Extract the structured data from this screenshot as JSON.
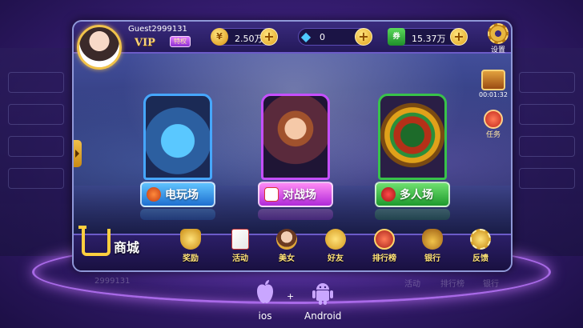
{
  "header": {
    "guest_name": "Guest2999131",
    "vip_label": "VIP",
    "vip_badge": "特权"
  },
  "resources": [
    {
      "name": "gold",
      "value": "2.50万",
      "icon": "coin-icon"
    },
    {
      "name": "diamond",
      "value": "0",
      "icon": "diamond-icon"
    },
    {
      "name": "ticket",
      "value": "15.37万",
      "icon": "ticket-icon",
      "icon_text": "券"
    }
  ],
  "settings_label": "设置",
  "chest_timer": "00:01:32",
  "task_label": "任务",
  "games": [
    {
      "label": "电玩场",
      "color": "#2f86e0"
    },
    {
      "label": "对战场",
      "color": "#c23ae0"
    },
    {
      "label": "多人场",
      "color": "#2aa83a"
    }
  ],
  "shop_label": "商城",
  "nav": [
    {
      "label": "奖励",
      "icon": "trophy-icon"
    },
    {
      "label": "活动",
      "icon": "cards-icon"
    },
    {
      "label": "美女",
      "icon": "girl-icon"
    },
    {
      "label": "好友",
      "icon": "friends-icon"
    },
    {
      "label": "排行榜",
      "icon": "ranking-icon"
    },
    {
      "label": "银行",
      "icon": "moneybag-icon"
    },
    {
      "label": "反馈",
      "icon": "feedback-icon"
    }
  ],
  "platforms": {
    "ios": "ios",
    "android": "Android",
    "separator": "+"
  },
  "background_ghosts": {
    "left_value": "2999131",
    "right_labels": [
      "活动",
      "排行榜",
      "银行"
    ]
  }
}
